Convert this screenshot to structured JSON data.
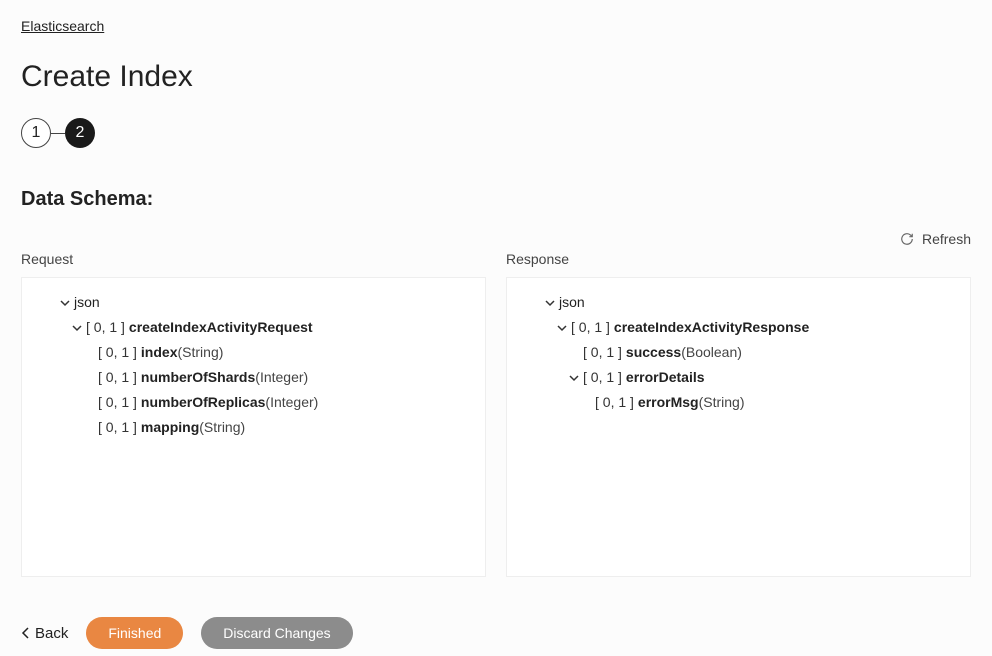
{
  "breadcrumb": "Elasticsearch",
  "page_title": "Create Index",
  "steps": [
    "1",
    "2"
  ],
  "section_heading": "Data Schema:",
  "refresh_label": "Refresh",
  "request_label": "Request",
  "response_label": "Response",
  "request_tree": [
    {
      "indent": 0,
      "expand": true,
      "bracket": "",
      "name": "json",
      "type": ""
    },
    {
      "indent": 1,
      "expand": true,
      "bracket": "[ 0, 1 ]",
      "name": "createIndexActivityRequest",
      "type": ""
    },
    {
      "indent": 2,
      "expand": false,
      "bracket": "[ 0, 1 ]",
      "name": "index",
      "type": "(String)"
    },
    {
      "indent": 2,
      "expand": false,
      "bracket": "[ 0, 1 ]",
      "name": "numberOfShards",
      "type": "(Integer)"
    },
    {
      "indent": 2,
      "expand": false,
      "bracket": "[ 0, 1 ]",
      "name": "numberOfReplicas",
      "type": "(Integer)"
    },
    {
      "indent": 2,
      "expand": false,
      "bracket": "[ 0, 1 ]",
      "name": "mapping",
      "type": "(String)"
    }
  ],
  "response_tree": [
    {
      "indent": 0,
      "expand": true,
      "bracket": "",
      "name": "json",
      "type": ""
    },
    {
      "indent": 1,
      "expand": true,
      "bracket": "[ 0, 1 ]",
      "name": "createIndexActivityResponse",
      "type": ""
    },
    {
      "indent": 2,
      "expand": false,
      "bracket": "[ 0, 1 ]",
      "name": "success",
      "type": "(Boolean)"
    },
    {
      "indent": 2,
      "expand": true,
      "bracket": "[ 0, 1 ]",
      "name": "errorDetails",
      "type": ""
    },
    {
      "indent": 3,
      "expand": false,
      "bracket": "[ 0, 1 ]",
      "name": "errorMsg",
      "type": "(String)"
    }
  ],
  "footer": {
    "back": "Back",
    "finished": "Finished",
    "discard": "Discard Changes"
  }
}
